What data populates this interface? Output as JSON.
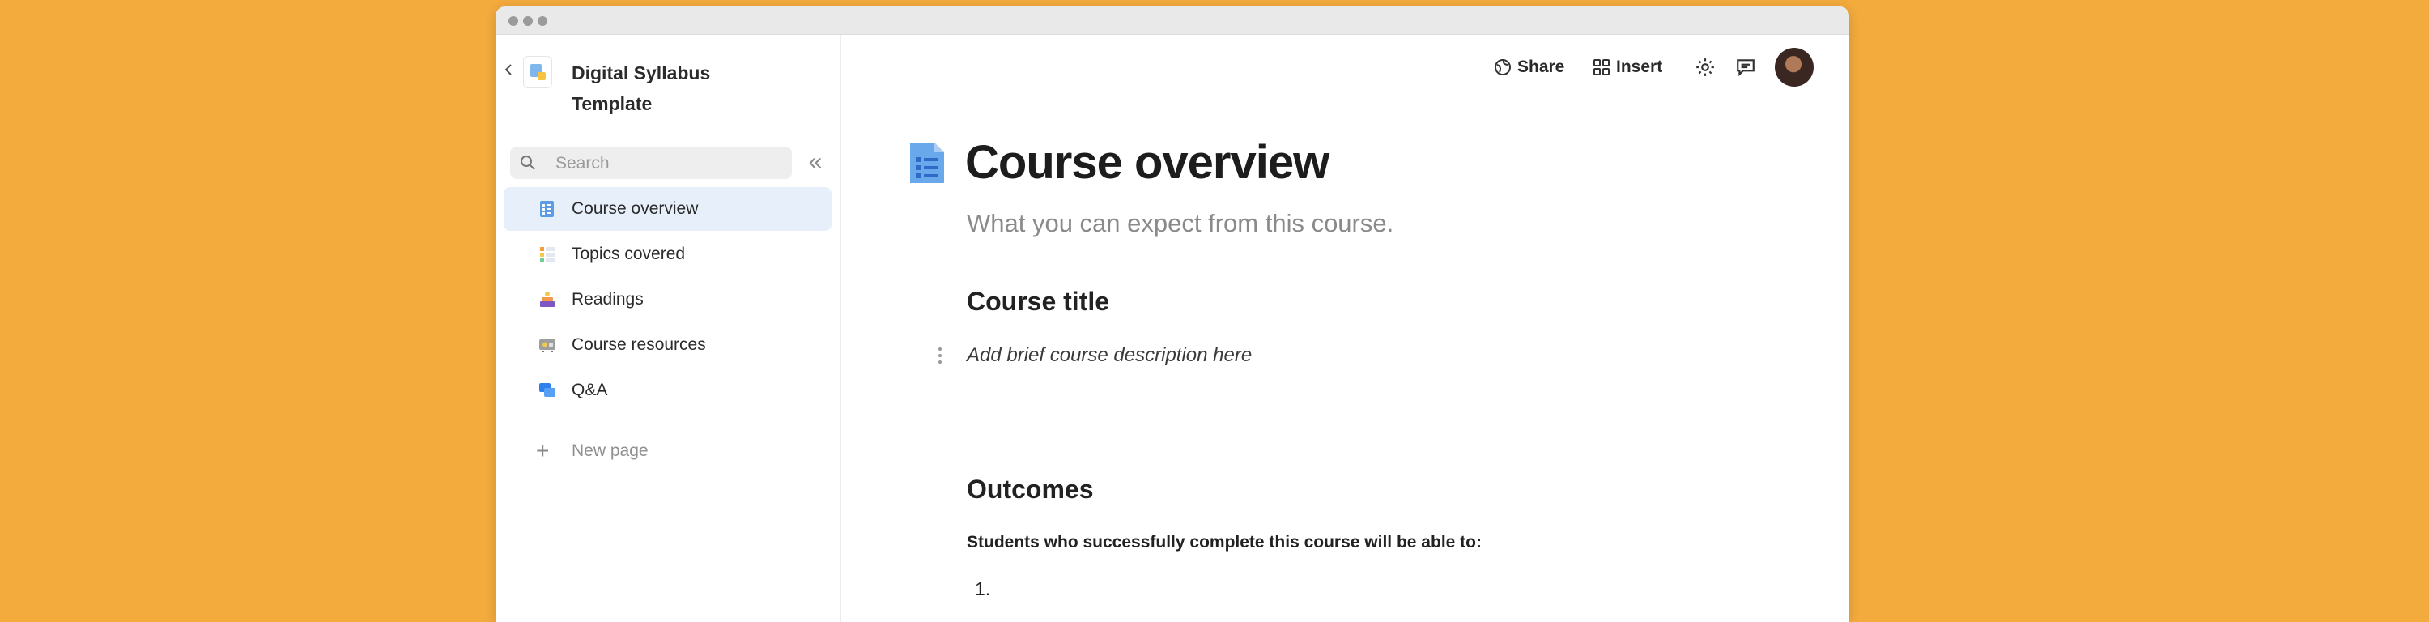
{
  "sidebar": {
    "doc_title": "Digital Syllabus Template",
    "search_placeholder": "Search",
    "collapse_icon": "«",
    "items": [
      {
        "label": "Course overview",
        "icon": "list-doc-icon",
        "active": true
      },
      {
        "label": "Topics covered",
        "icon": "grid-icon",
        "active": false
      },
      {
        "label": "Readings",
        "icon": "books-icon",
        "active": false
      },
      {
        "label": "Course resources",
        "icon": "projector-icon",
        "active": false
      },
      {
        "label": "Q&A",
        "icon": "chat-bubbles-icon",
        "active": false
      }
    ],
    "new_page_label": "New page"
  },
  "toolbar": {
    "share_label": "Share",
    "insert_label": "Insert"
  },
  "page": {
    "title": "Course overview",
    "subtitle": "What you can expect from this course.",
    "section1_heading": "Course title",
    "section1_text": "Add brief course description here",
    "section2_heading": "Outcomes",
    "section2_intro": "Students who successfully complete this course will be able to:",
    "list_marker": "1."
  },
  "colors": {
    "background": "#F4AB3D",
    "active_item": "#E7F0FA",
    "accent_blue": "#4A90E2"
  }
}
